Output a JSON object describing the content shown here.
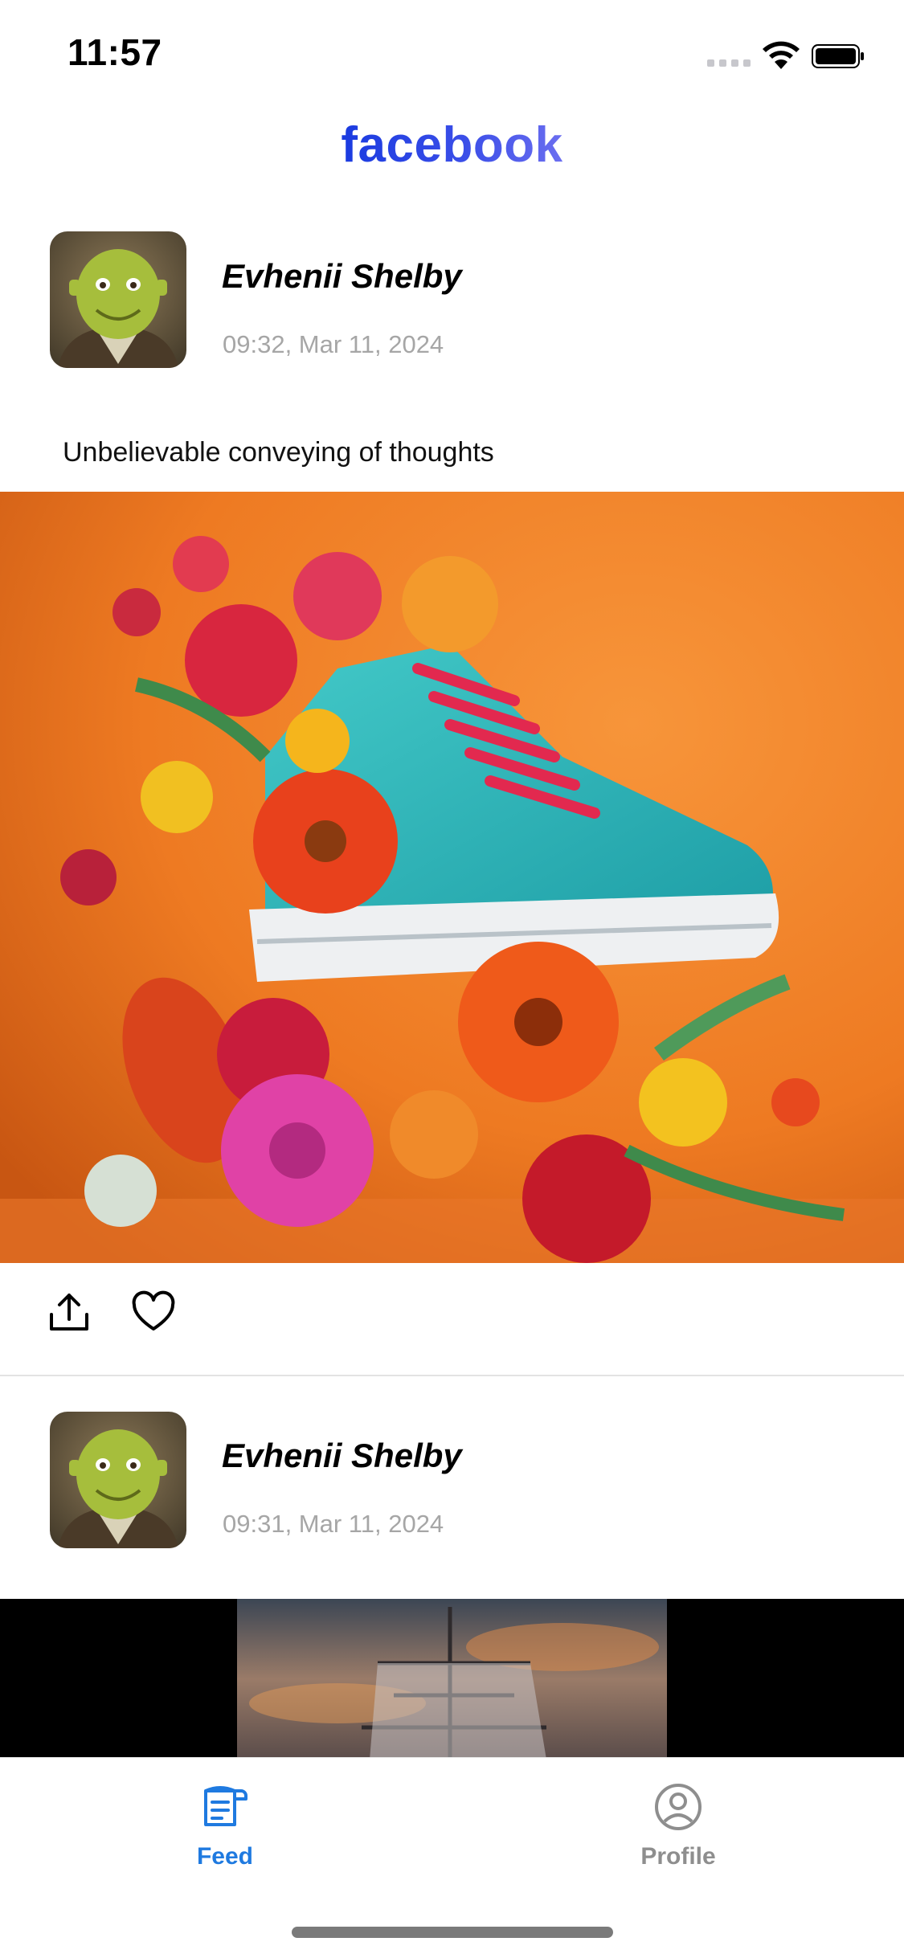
{
  "status_bar": {
    "time": "11:57"
  },
  "header": {
    "logo": "facebook"
  },
  "feed": {
    "posts": [
      {
        "author": "Evhenii Shelby",
        "timestamp": "09:32, Mar 11, 2024",
        "caption": "Unbelievable conveying of thoughts",
        "media": "sneaker-with-flowers-photo"
      },
      {
        "author": "Evhenii Shelby",
        "timestamp": "09:31, Mar 11, 2024",
        "media": "sailing-ship-video"
      }
    ]
  },
  "actions": {
    "share_icon": "share-icon",
    "like_icon": "heart-icon"
  },
  "tabbar": {
    "items": [
      {
        "label": "Feed",
        "icon": "feed-icon",
        "active": true
      },
      {
        "label": "Profile",
        "icon": "profile-icon",
        "active": false
      }
    ]
  },
  "colors": {
    "accent": "#1f7ae0",
    "inactive": "#8e8e8e",
    "timestamp": "#a6a6a6",
    "logo": "#1a3be0"
  }
}
